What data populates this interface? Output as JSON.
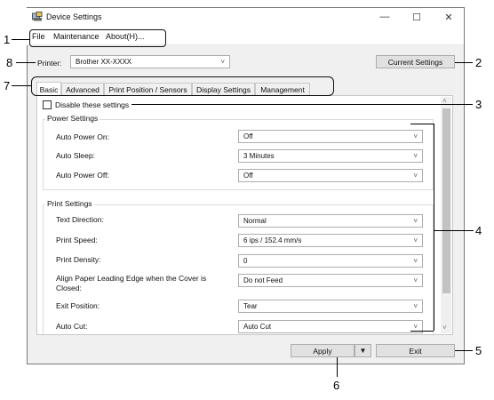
{
  "window": {
    "title": "Device Settings",
    "minimize": "—",
    "maximize": "☐",
    "close": "✕"
  },
  "menu": [
    "File",
    "Maintenance",
    "About(H)..."
  ],
  "printer": {
    "label": "Printer:",
    "value": "Brother  XX-XXXX"
  },
  "current_settings_label": "Current Settings",
  "tabs": [
    "Basic",
    "Advanced",
    "Print Position / Sensors",
    "Display Settings",
    "Management"
  ],
  "disable_label": "Disable these settings",
  "power": {
    "title": "Power Settings",
    "rows": [
      {
        "label": "Auto Power On:",
        "value": "Off"
      },
      {
        "label": "Auto Sleep:",
        "value": "3 Minutes"
      },
      {
        "label": "Auto Power Off:",
        "value": "Off"
      }
    ]
  },
  "print": {
    "title": "Print Settings",
    "rows": [
      {
        "label": "Text Direction:",
        "value": "Normal"
      },
      {
        "label": "Print Speed:",
        "value": "6 ips / 152.4 mm/s"
      },
      {
        "label": "Print Density:",
        "value": "0"
      },
      {
        "label": "Align Paper Leading Edge when the Cover is",
        "label2": "Closed:",
        "value": "Do not Feed"
      },
      {
        "label": "Exit Position:",
        "value": "Tear"
      },
      {
        "label": "Auto Cut:",
        "value": "Auto Cut"
      }
    ]
  },
  "buttons": {
    "apply": "Apply",
    "exit": "Exit",
    "dropdown": "▼"
  },
  "callouts": [
    "1",
    "2",
    "3",
    "4",
    "5",
    "6",
    "7",
    "8"
  ],
  "chevron": "˅",
  "scroll_up": "˄",
  "scroll_down": "˅"
}
